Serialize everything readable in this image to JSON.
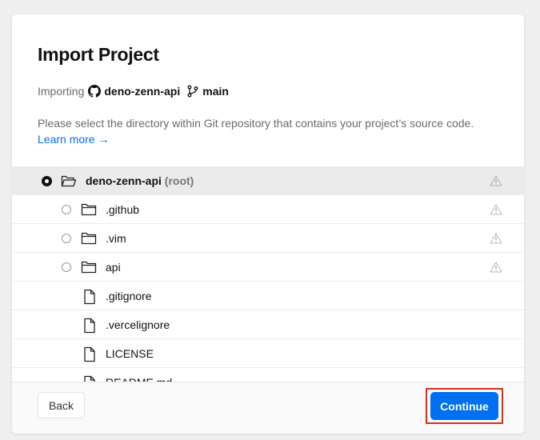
{
  "header": {
    "title": "Import Project",
    "importing_label": "Importing",
    "repo_name": "deno-zenn-api",
    "branch_name": "main",
    "description": "Please select the directory within Git repository that contains your project’s source code.",
    "learn_more": "Learn more →"
  },
  "tree": {
    "root": {
      "name": "deno-zenn-api",
      "tag": "(root)",
      "selected": true
    },
    "items": [
      {
        "name": ".github",
        "type": "folder"
      },
      {
        "name": ".vim",
        "type": "folder"
      },
      {
        "name": "api",
        "type": "folder"
      },
      {
        "name": ".gitignore",
        "type": "file"
      },
      {
        "name": ".vercelignore",
        "type": "file"
      },
      {
        "name": "LICENSE",
        "type": "file"
      },
      {
        "name": "README.md",
        "type": "file"
      }
    ]
  },
  "footer": {
    "back_label": "Back",
    "continue_label": "Continue"
  },
  "colors": {
    "accent": "#0070f3",
    "highlight_box": "#d2321f"
  }
}
